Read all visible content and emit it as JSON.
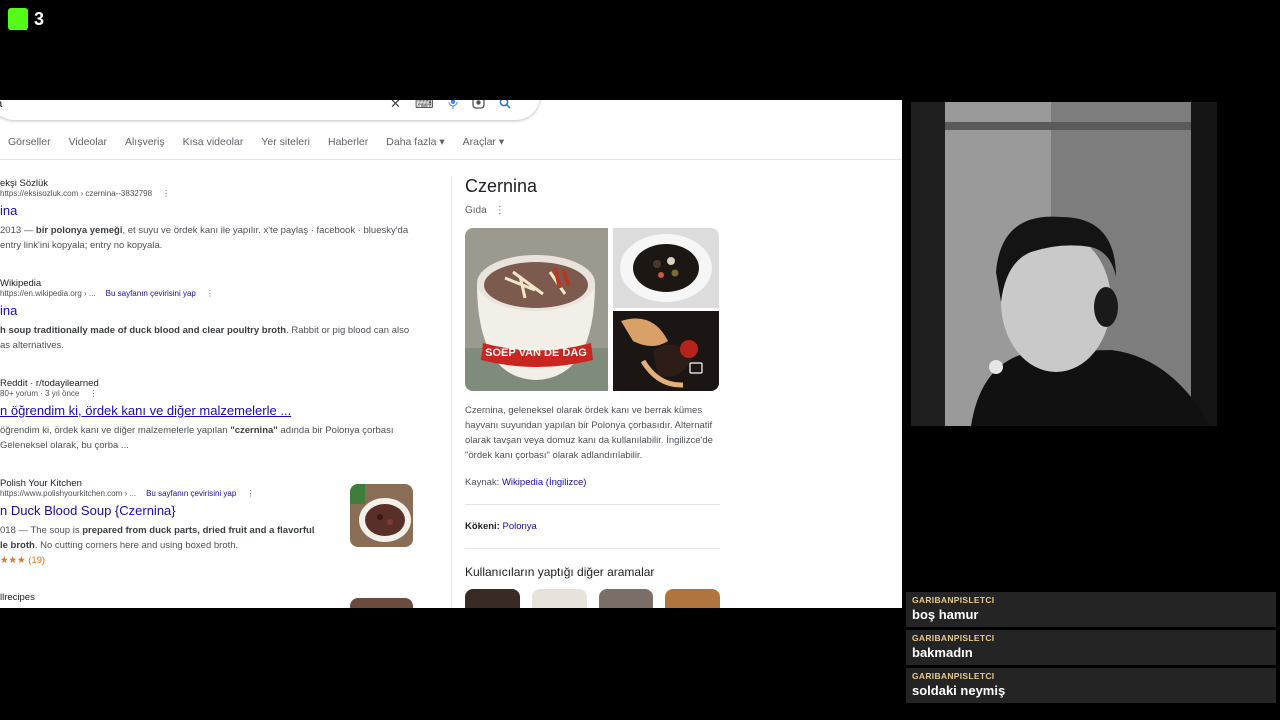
{
  "overlay": {
    "logo_number": "3"
  },
  "search": {
    "query": "na"
  },
  "tabs": [
    "Görseller",
    "Videolar",
    "Alışveriş",
    "Kısa videolar",
    "Yer siteleri",
    "Haberler",
    "Daha fazla ▾",
    "Araçlar ▾"
  ],
  "results": [
    {
      "site": "ekşi Sözlük",
      "url": "https://eksisozluk.com › czernina--3832798",
      "title": "ina",
      "snippet_pre": "2013 — ",
      "snippet_bold": "bir polonya yemeği",
      "snippet_post": ", et suyu ve ördek kanı ile yapılır. x'te paylaş · facebook · bluesky'da",
      "snippet_line2": "entry link'ini kopyala; entry no kopyala."
    },
    {
      "site": "Wikipedia",
      "url": "https://en.wikipedia.org › ...",
      "translate": "Bu sayfanın çevirisini yap",
      "title": "ina",
      "snippet_bold": "h soup traditionally made of duck blood and clear poultry broth",
      "snippet_post": ". Rabbit or pig blood can also",
      "snippet_line2": "as alternatives."
    },
    {
      "site": "Reddit · r/todayilearned",
      "url": "80+ yorum · 3 yıl önce",
      "title": "n öğrendim ki, ördek kanı ve diğer malzemelerle ...",
      "snippet_pre": "öğrendim ki, ördek kanı ve diğer malzemelerle yapılan ",
      "snippet_bold": "\"czernina\"",
      "snippet_post": " adında bir Polonya çorbası",
      "snippet_line2": "Geleneksel olarak, bu çorba ..."
    },
    {
      "site": "Polish Your Kitchen",
      "url": "https://www.polishyourkitchen.com › ...",
      "translate": "Bu sayfanın çevirisini yap",
      "title": "n Duck Blood Soup {Czernina}",
      "snippet_pre": "018 — The soup is ",
      "snippet_bold": "prepared from duck parts, dried fruit and a flavorful",
      "snippet_line2_bold": "le broth",
      "snippet_line2": ". No cutting corners here and using boxed broth.",
      "rating": "★★★ (19)"
    },
    {
      "site": "llrecipes"
    }
  ],
  "knowledge_panel": {
    "title": "Czernina",
    "subtitle": "Gıda",
    "description": "Czernina, geleneksel olarak ördek kanı ve berrak kümes hayvanı suyundan yapılan bir Polonya çorbasıdır. Alternatif olarak tavşan veya domuz kanı da kullanılabilir. İngilizce'de \"ördek kanı çorbası\" olarak adlandırılabilir.",
    "source_label": "Kaynak:",
    "source_link": "Wikipedia (İngilizce)",
    "origin_label": "Kökeni:",
    "origin_value": "Polonya",
    "others_title": "Kullanıcıların yaptığı diğer aramalar",
    "image_text": "SOEP VAN DE DAG"
  },
  "chat": [
    {
      "user": "GARIBANPISLETCI",
      "text": "boş hamur"
    },
    {
      "user": "GARIBANPISLETCI",
      "text": "bakmadın"
    },
    {
      "user": "GARIBANPISLETCI",
      "text": "soldaki neymiş"
    }
  ]
}
